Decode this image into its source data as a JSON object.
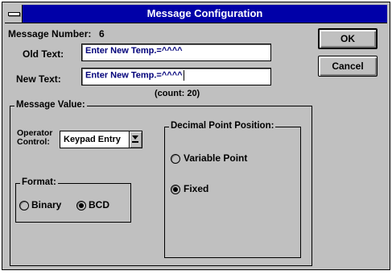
{
  "window": {
    "title": "Message Configuration"
  },
  "message_number": {
    "label": "Message Number:",
    "value": "6"
  },
  "old_text": {
    "label": "Old Text:",
    "value": "Enter New Temp.=^^^^"
  },
  "new_text": {
    "label": "New Text:",
    "value": "Enter New Temp.=^^^^"
  },
  "count_text": "(count: 20)",
  "buttons": {
    "ok": "OK",
    "cancel": "Cancel"
  },
  "message_value": {
    "legend": "Message Value:",
    "operator_control": {
      "label_line1": "Operator",
      "label_line2": "Control:",
      "value": "Keypad Entry"
    },
    "format": {
      "legend": "Format:",
      "options": [
        {
          "label": "Binary",
          "selected": false
        },
        {
          "label": "BCD",
          "selected": true
        }
      ]
    }
  },
  "decimal_point": {
    "legend": "Decimal Point Position:",
    "options": [
      {
        "label": "Variable Point",
        "selected": false
      },
      {
        "label": "Fixed",
        "selected": true
      }
    ]
  }
}
